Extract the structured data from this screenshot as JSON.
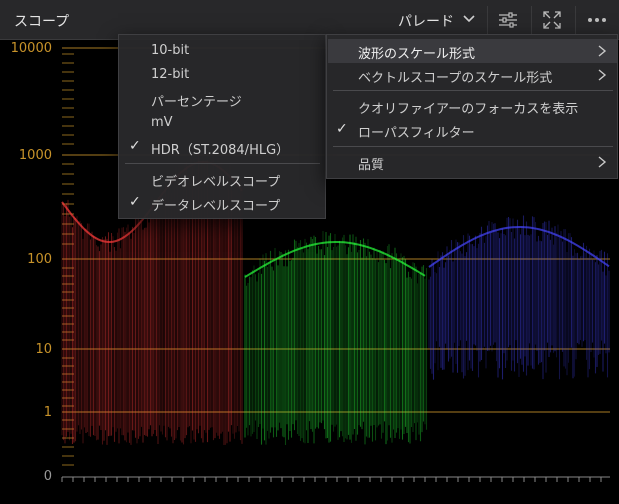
{
  "header": {
    "title": "スコープ",
    "mode_label": "パレード",
    "icons": [
      "chevron-down-icon",
      "sliders-icon",
      "expand-icon",
      "more-icon"
    ]
  },
  "scope": {
    "y_labels": [
      "10000",
      "1000",
      "100",
      "10",
      "1",
      "0"
    ],
    "label_color": "#c8932a",
    "channels": [
      {
        "name": "red",
        "color": "#ff3c3c"
      },
      {
        "name": "green",
        "color": "#28ff3c"
      },
      {
        "name": "blue",
        "color": "#4646ff"
      }
    ]
  },
  "menu_left": {
    "items": [
      "10-bit",
      "12-bit",
      "パーセンテージ",
      "mV",
      "HDR（ST.2084/HLG）"
    ],
    "checked_index": 4,
    "items2": [
      "ビデオレベルスコープ",
      "データレベルスコープ"
    ],
    "checked2_index": 1
  },
  "menu_right": {
    "items": [
      {
        "label": "波形のスケール形式",
        "submenu": true
      },
      {
        "label": "ベクトルスコープのスケール形式",
        "submenu": true
      }
    ],
    "items2": [
      {
        "label": "クオリファイアーのフォーカスを表示",
        "checked": false
      },
      {
        "label": "ローパスフィルター",
        "checked": true
      }
    ],
    "items3": [
      {
        "label": "品質",
        "submenu": true
      }
    ]
  }
}
